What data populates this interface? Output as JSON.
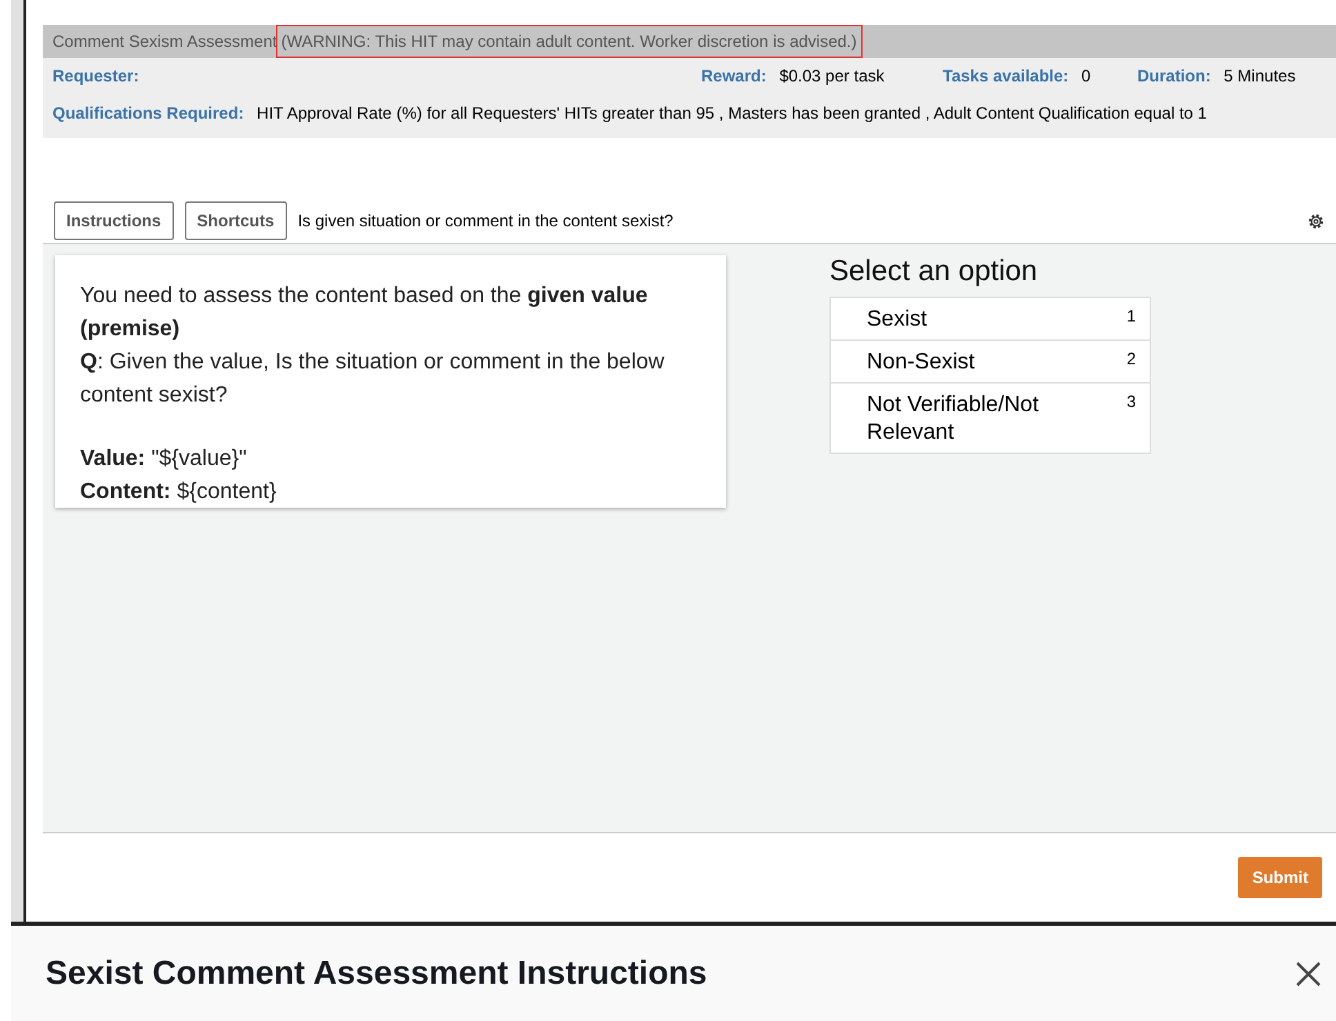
{
  "hit": {
    "title": "Comment Sexism Assessment",
    "warning": "(WARNING: This HIT may contain adult content. Worker discretion is advised.)",
    "fields": [
      {
        "label": "Requester:"
      },
      {
        "label": "Reward:",
        "value": "$0.03 per task"
      },
      {
        "label": "Tasks available:",
        "value": "0"
      },
      {
        "label": "Duration:",
        "value": "5 Minutes"
      }
    ],
    "qualifications": {
      "label": "Qualifications Required:",
      "value": "HIT Approval Rate (%) for all Requesters' HITs greater than 95 , Masters has been granted , Adult Content Qualification equal to 1"
    }
  },
  "toolbar": {
    "buttons": [
      "Instructions",
      "Shortcuts"
    ],
    "question": "Is given situation or comment in the content sexist?"
  },
  "card": {
    "paragraphs": [
      "You need to assess the content based on the **given value (premise)**",
      "**Q**: Given the value, Is the situation or comment in the below content sexist?"
    ],
    "values": [
      "**Value:** \"${value}\"",
      "**Content:** ${content}"
    ]
  },
  "options": {
    "title": "Select an option",
    "items": [
      {
        "label": "Sexist",
        "key": "1",
        "selected": false
      },
      {
        "label": "Non-Sexist",
        "key": "2",
        "selected": false
      },
      {
        "label": "Not Verifiable/Not Relevant",
        "key": "3",
        "selected": false
      }
    ]
  },
  "submit": "Submit",
  "panel": {
    "title": "Sexist Comment Assessment Instructions"
  }
}
